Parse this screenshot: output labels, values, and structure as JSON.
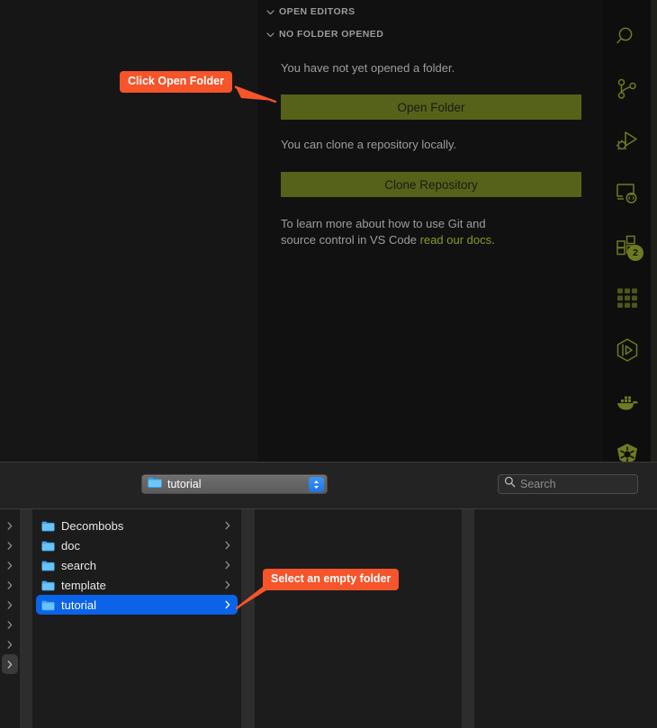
{
  "colors": {
    "accent_callout": "#f6542a",
    "vscode_button": "#56621a",
    "vscode_link": "#8a9a24",
    "selection_blue": "#0a63e8",
    "badge_bg": "#6d7a1e"
  },
  "vscode": {
    "sections": [
      {
        "label": "OPEN EDITORS",
        "icon": "chevron-down-icon",
        "expanded": true
      },
      {
        "label": "NO FOLDER OPENED",
        "icon": "chevron-down-icon",
        "expanded": true
      }
    ],
    "body": {
      "text_no_folder": "You have not yet opened a folder.",
      "open_folder_button": "Open Folder",
      "text_clone": "You can clone a repository locally.",
      "clone_repo_button": "Clone Repository",
      "docs_text_line1": "To learn more about how to use Git and",
      "docs_text_line2_prefix": "source control in VS Code ",
      "docs_link": "read our docs",
      "docs_text_suffix": "."
    },
    "activity_bar": [
      {
        "name": "search-icon",
        "label": "Search",
        "badge": null
      },
      {
        "name": "source-control-icon",
        "label": "Source Control",
        "badge": null
      },
      {
        "name": "run-and-debug-icon",
        "label": "Run and Debug",
        "badge": null
      },
      {
        "name": "remote-explorer-icon",
        "label": "Remote Explorer",
        "badge": null
      },
      {
        "name": "extensions-icon",
        "label": "Extensions",
        "badge": "2"
      },
      {
        "name": "apps-grid-icon",
        "label": "Apps Grid",
        "badge": null
      },
      {
        "name": "box-3d-icon",
        "label": "Container Tools",
        "badge": null
      },
      {
        "name": "docker-whale-icon",
        "label": "Docker",
        "badge": null
      },
      {
        "name": "kubernetes-icon",
        "label": "Kubernetes",
        "badge": null
      }
    ]
  },
  "dialog": {
    "path_popup": {
      "value": "tutorial",
      "icon": "folder-icon",
      "stepper_icon": "chevron-up-down-icon"
    },
    "search": {
      "placeholder": "Search",
      "value": "",
      "icon": "search-icon"
    },
    "columns": [
      {
        "name": "column-partial-left",
        "rows": [
          {
            "label": "",
            "disclosure": "chevron-right-icon",
            "selected": false
          },
          {
            "label": "",
            "disclosure": "chevron-right-icon",
            "selected": false
          },
          {
            "label": "",
            "disclosure": "chevron-right-icon",
            "selected": false
          },
          {
            "label": "",
            "disclosure": "chevron-right-icon",
            "selected": false
          },
          {
            "label": "",
            "disclosure": "chevron-right-icon",
            "selected": false
          },
          {
            "label": "",
            "disclosure": "chevron-right-icon",
            "selected": false
          },
          {
            "label": "",
            "disclosure": "chevron-right-icon",
            "selected": false
          },
          {
            "label": "",
            "disclosure": "chevron-right-icon",
            "selected": true
          }
        ]
      },
      {
        "name": "column-folder-list",
        "rows": [
          {
            "label": "Decombobs",
            "disclosure": "chevron-right-icon",
            "selected": false
          },
          {
            "label": "doc",
            "disclosure": "chevron-right-icon",
            "selected": false
          },
          {
            "label": "search",
            "disclosure": "chevron-right-icon",
            "selected": false
          },
          {
            "label": "template",
            "disclosure": "chevron-right-icon",
            "selected": false
          },
          {
            "label": "tutorial",
            "disclosure": "chevron-right-icon",
            "selected": true
          }
        ]
      },
      {
        "name": "column-empty-preview",
        "rows": []
      },
      {
        "name": "column-empty-far-right",
        "rows": []
      }
    ]
  },
  "annotations": [
    {
      "id": "callout-click-open-folder",
      "text": "Click Open Folder"
    },
    {
      "id": "callout-select-empty-folder",
      "text": "Select an empty folder"
    }
  ]
}
